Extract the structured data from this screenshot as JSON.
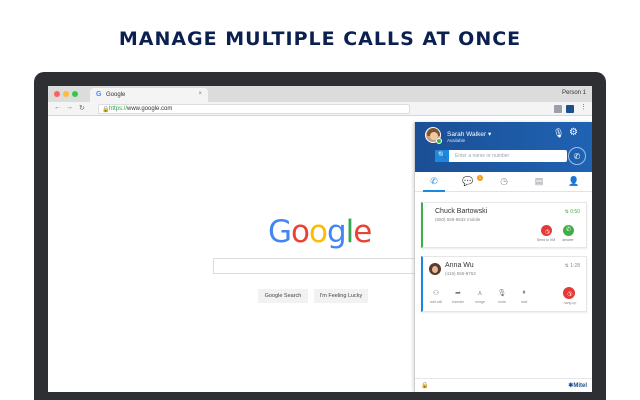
{
  "headline": "MANAGE MULTIPLE CALLS AT ONCE",
  "browser": {
    "tab_title": "Google",
    "tab_close": "×",
    "profile": "Person 1",
    "url_scheme": "https://",
    "url_host": "www.google.com",
    "favicon": "G",
    "lock": "🔒",
    "nav": {
      "back": "←",
      "forward": "→",
      "reload": "↻"
    }
  },
  "google": {
    "logo_letters": [
      {
        "ch": "G",
        "color": "#4285F4"
      },
      {
        "ch": "o",
        "color": "#EA4335"
      },
      {
        "ch": "o",
        "color": "#FBBC05"
      },
      {
        "ch": "g",
        "color": "#4285F4"
      },
      {
        "ch": "l",
        "color": "#34A853"
      },
      {
        "ch": "e",
        "color": "#EA4335"
      }
    ],
    "search_button": "Google Search",
    "lucky_button": "I'm Feeling Lucky"
  },
  "widget": {
    "user_name": "Sarah Walker ▾",
    "user_status": "Available",
    "search_placeholder": "Enter a name or number",
    "icons": {
      "search": "🔍",
      "mic": "🎙",
      "gear": "⚙",
      "dial": "✆",
      "tab_calls": "✆",
      "tab_messages": "💬",
      "tab_history": "◷",
      "tab_voicemail": "▤",
      "tab_contacts": "👤",
      "decline": "✆",
      "answer": "✆",
      "hangup": "✆",
      "add_call": "⚇",
      "transfer": "➦",
      "merge": "⋏",
      "mute": "🎙",
      "hold": "⏸",
      "lock": "🔒"
    },
    "messages_badge": "1",
    "calls": [
      {
        "name": "Chuck Bartowski",
        "number": "(650) 555-9632 mobile",
        "time": "0:50",
        "time_icon": "⇅",
        "decline_label": "Send to VM",
        "answer_label": "answer"
      },
      {
        "name": "Anna Wu",
        "number": "(415) 555-8763",
        "time": "1:28",
        "time_icon": "⇅",
        "actions": [
          "add call",
          "transfer",
          "merge",
          "mute",
          "hold"
        ],
        "hangup_label": "hang up"
      }
    ],
    "brand": "✱Mitel"
  },
  "colors": {
    "headline": "#0b2050",
    "accent": "#1a88e0",
    "header_blue": "#1e5fa8",
    "answer_green": "#3cb043",
    "decline_red": "#e53935"
  }
}
